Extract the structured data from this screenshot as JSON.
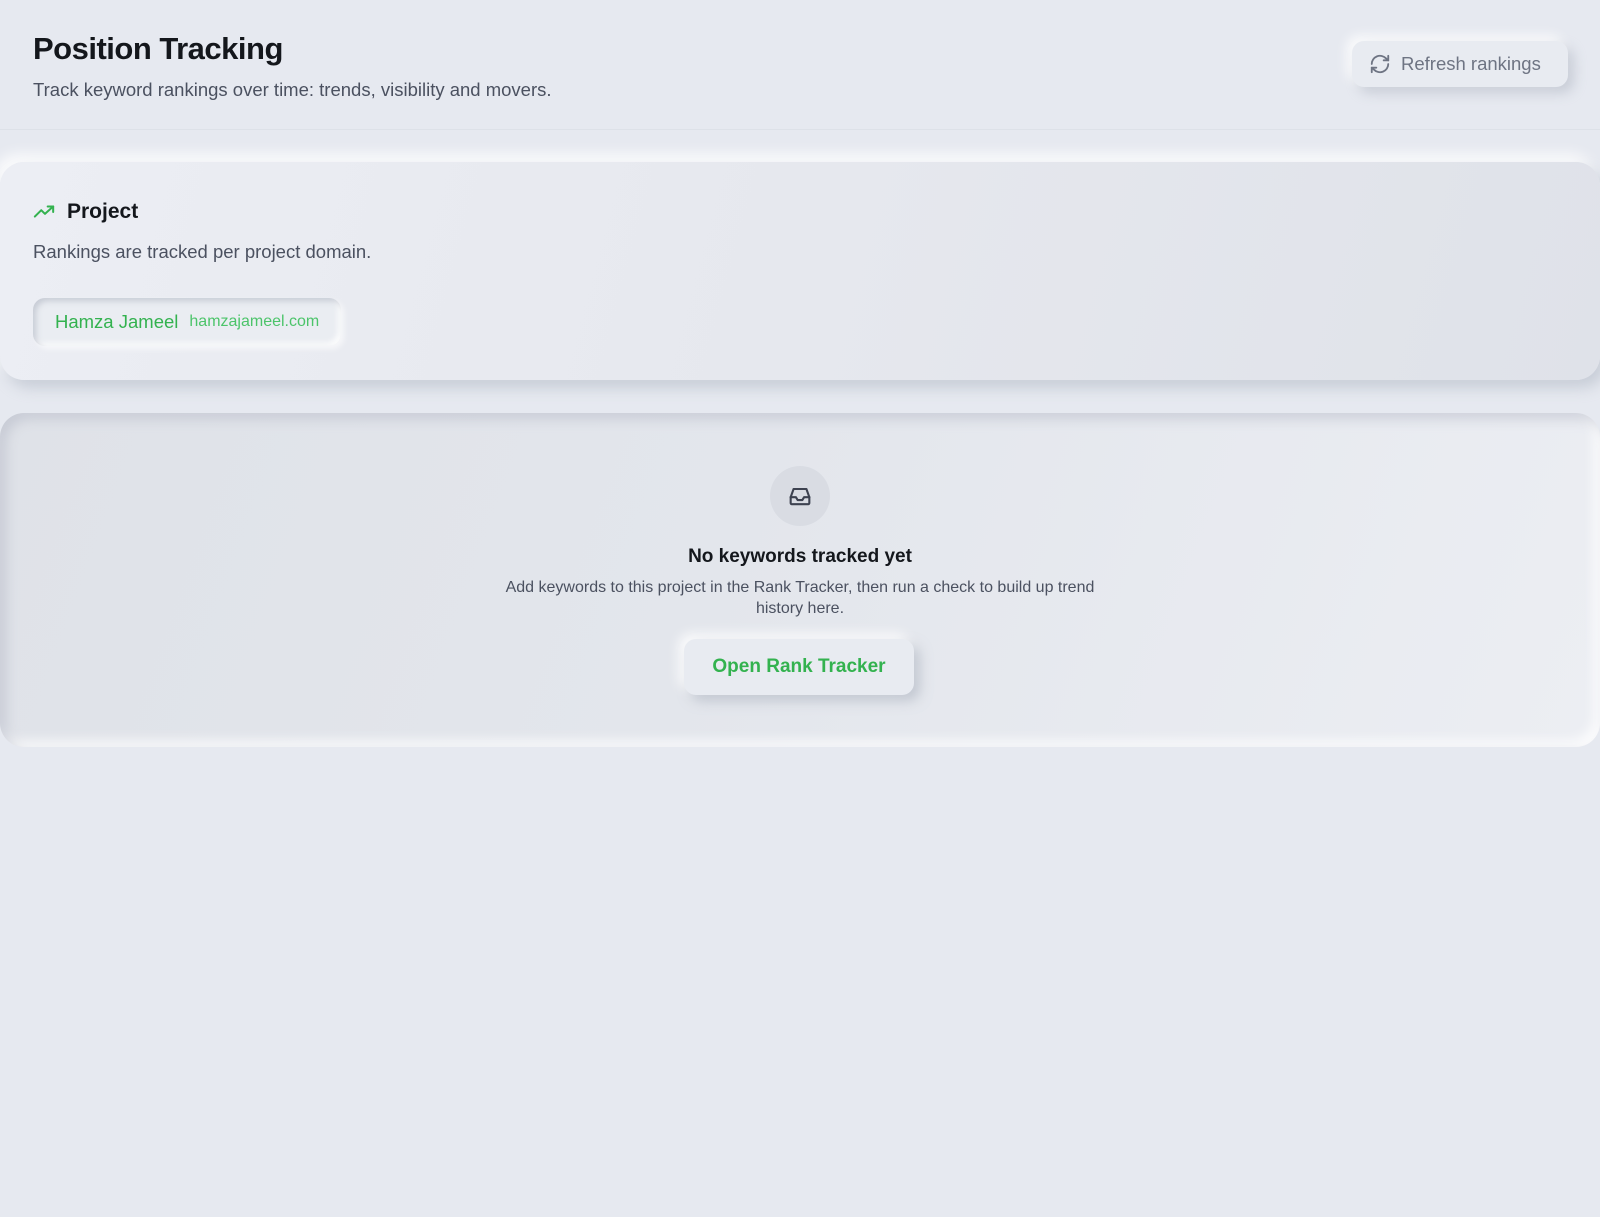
{
  "header": {
    "title": "Position Tracking",
    "subtitle": "Track keyword rankings over time: trends, visibility and movers.",
    "refresh_label": "Refresh rankings"
  },
  "project": {
    "title": "Project",
    "description": "Rankings are tracked per project domain.",
    "selected": {
      "name": "Hamza Jameel",
      "domain": "hamzajameel.com"
    }
  },
  "empty_state": {
    "title": "No keywords tracked yet",
    "description": "Add keywords to this project in the Rank Tracker, then run a check to build up trend history here.",
    "action_label": "Open Rank Tracker"
  },
  "icons": {
    "refresh": "refresh-icon",
    "project": "trending-up-icon",
    "empty": "inbox-icon"
  },
  "colors": {
    "accent": "#33b24f",
    "background": "#e6e9f0",
    "text_primary": "#14171c",
    "text_secondary": "#4b5160"
  }
}
